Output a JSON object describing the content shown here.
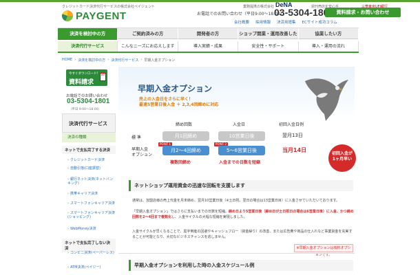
{
  "header": {
    "tagline": "クレジットカード決済代行サービスの株式会社ペイジェント",
    "logo": "PAYGENT",
    "partner_label": "業務提携の株式会社",
    "dena": "DeNA",
    "ec_label": "週刊売店を安心手",
    "mufg": "三菱東京UFJ銀行",
    "contact_label": "お電話でのお問い合わせ（平日9:00〜18:00）",
    "phone": "03-5304-1801",
    "request_button": "資料請求・お問い合わせ",
    "links": [
      "会社概要",
      "採用情報",
      "決済用語集",
      "ECサイト成功コラム"
    ]
  },
  "gnav": [
    {
      "label": "決済を検討中の方",
      "active": true
    },
    {
      "label": "ご契約済みの方",
      "active": false
    },
    {
      "label": "開発者の方",
      "active": false
    },
    {
      "label": "ショップ開業・運用改善したい方",
      "active": false
    },
    {
      "label": "協業したい方",
      "active": false
    }
  ],
  "snav": [
    {
      "label": "決済代行サービス",
      "active": true
    },
    {
      "label": "こんなニーズにお応えします",
      "active": false
    },
    {
      "label": "導入実績・成果",
      "active": false
    },
    {
      "label": "安全性・サポート",
      "active": false
    },
    {
      "label": "導入・運用の流れ",
      "active": false
    }
  ],
  "breadcrumb": [
    "HOME",
    "決済を検討中の方",
    "決済代行サービス",
    "早期入金オプション"
  ],
  "sidebar": {
    "req_small": "今すぐダウンロード！",
    "req_big": "資料請求",
    "pdf": "PDF",
    "contact": "お電話でのお問い合わせ",
    "phone": "03-5304-1801",
    "hours": "（平日 9:00〜18:00）",
    "title": "決済代行サービス",
    "current": "決済の種類",
    "section1": "ネットで支払完了する決済",
    "links1": [
      "クレジットカード決済",
      "自動引落(口座振替)",
      "銀行ネット決済(ネットバンキング)",
      "携帯キャリア決済",
      "スマートフォンキャリア決済",
      "スマートフォンキャリア決済(ショッピング)",
      "WebMoney決済"
    ],
    "section2": "ネットで支払完了しない決済",
    "links2": [
      "コンビニ決済(ペーパーレス)",
      "ATM決済(ペイジー)"
    ]
  },
  "hero": {
    "title": "早期入金オプション",
    "sub1": "売上の入金日をさらに早く！",
    "sub2": "最速5営業日後入金 ＋ 2,3,4回締めに対応"
  },
  "flow": {
    "col1": "締め回数",
    "col2": "入金日",
    "col3": "初回入金日例",
    "std_label": "標 準",
    "std_close": "月1回締め",
    "std_pay": "10営業日後",
    "std_first": "翌月13日",
    "opt_label1": "早期入金",
    "opt_label2": "オプション",
    "point1": "POINT 1",
    "point2": "POINT 2",
    "opt_close": "月2〜4回締め",
    "opt_pay": "5〜6営業日後",
    "opt_first": "当月14日",
    "note1": "複数回締め",
    "note2": "入金までの日数を短縮",
    "circle1": "初回入金が",
    "circle2": "1ヶ月早い"
  },
  "section1": {
    "title": "ネットショップ運用資金の迅速な回転を支援します",
    "p1": "通常は、加盟店様の売上代金を月末締め、翌月10営業日後（※土日祝、翌日の場合は13営業日目）に入金させていただいております。",
    "p2a": "「早期入金オプション」ではさらに支払いまでの日数を短縮。",
    "p2b": "締め日より5営業日後（締め日が土日祝日の場合は6営業日後）に入金",
    "p2c": "、かつ締め回数を2〜4回まで複数化",
    "p2d": "し、入金サイクルの大幅な短縮を実現しました。",
    "p3": "入金サイクルが早くなることで、黒字倒産の回避やキャッシュフロー（資金繰り）の改善、または広告費や商品の仕入れなど事業資金を充実することが可能となり、大切なビジネスチャンスを逃しません。",
    "fee": "※早期入金オプションは有料オプションです。"
  },
  "section2": {
    "title": "早期入金オプションを利用した時の入金スケジュール例"
  }
}
